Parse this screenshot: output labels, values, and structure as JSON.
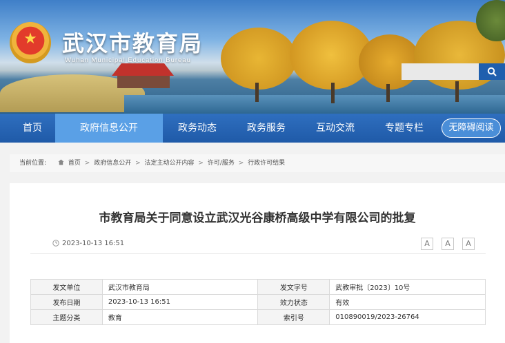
{
  "header": {
    "site_title": "武汉市教育局",
    "site_subtitle": "Wuhan Municipal Education Bureau",
    "emblem_icon": "national-emblem",
    "search": {
      "placeholder": "",
      "button_icon": "search-icon"
    }
  },
  "nav": {
    "items": [
      {
        "label": "首页",
        "active": false
      },
      {
        "label": "政府信息公开",
        "active": true
      },
      {
        "label": "政务动态",
        "active": false
      },
      {
        "label": "政务服务",
        "active": false
      },
      {
        "label": "互动交流",
        "active": false
      },
      {
        "label": "专题专栏",
        "active": false
      }
    ],
    "accessibility_label": "无障碍阅读"
  },
  "breadcrumb": {
    "label": "当前位置:",
    "home_icon": "home-icon",
    "items": [
      "首页",
      "政府信息公开",
      "法定主动公开内容",
      "许可/服务",
      "行政许可结果"
    ],
    "separator": ">"
  },
  "article": {
    "title": "市教育局关于同意设立武汉光谷康桥高级中学有限公司的批复",
    "date": "2023-10-13 16:51",
    "font_buttons": [
      "A",
      "A",
      "A"
    ]
  },
  "info_table": {
    "rows": [
      {
        "k1": "发文单位",
        "v1": "武汉市教育局",
        "k2": "发文字号",
        "v2": "武教审批〔2023〕10号"
      },
      {
        "k1": "发布日期",
        "v1": "2023-10-13 16:51",
        "k2": "效力状态",
        "v2": "有效"
      },
      {
        "k1": "主题分类",
        "v1": "教育",
        "k2": "索引号",
        "v2": "010890019/2023-26764"
      }
    ]
  },
  "colors": {
    "nav_bg": "#1f5aa8",
    "nav_active": "#5aa0e6",
    "search_button": "#1f5fae"
  }
}
